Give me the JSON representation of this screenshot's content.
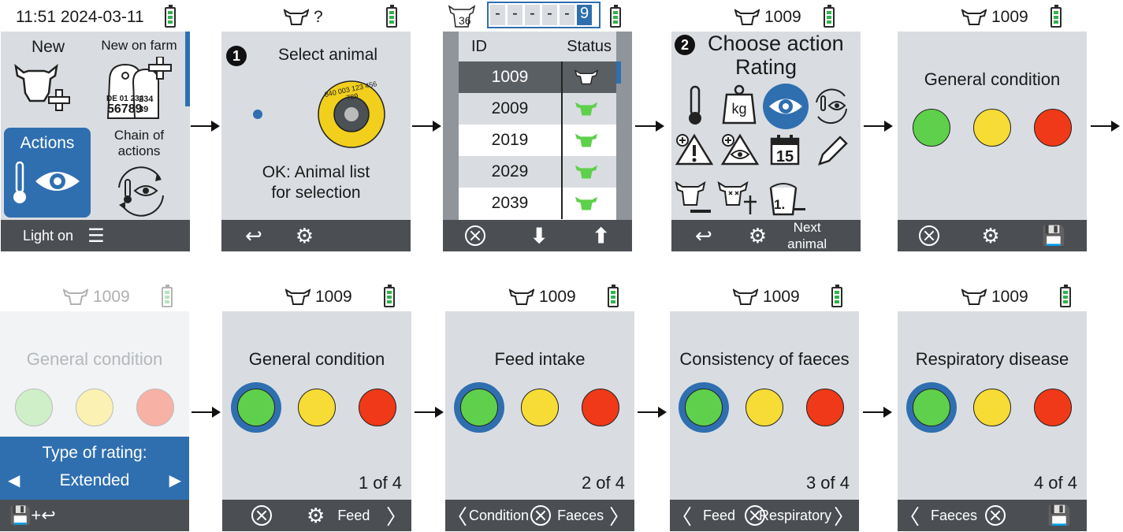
{
  "row1": {
    "s1": {
      "time": "11:51 2024-03-11",
      "new": "New",
      "new_on_farm": "New on farm",
      "actions": "Actions",
      "chain": "Chain of\nactions",
      "light": "Light on",
      "tag_line1": "DE 01 234",
      "tag_line2": "56789",
      "tag_side": "234\n39"
    },
    "s2": {
      "id": "?",
      "step": "1",
      "title": "Select animal",
      "ok": "OK: Animal list\nfor selection",
      "tag_text": "840 003 123 456 789"
    },
    "s3": {
      "count": "36",
      "digits": [
        "-",
        "-",
        "-",
        "-",
        "-",
        "9"
      ],
      "col_id": "ID",
      "col_status": "Status",
      "rows": [
        "1009",
        "2009",
        "2019",
        "2029",
        "2039"
      ]
    },
    "s4": {
      "id": "1009",
      "step": "2",
      "title1": "Choose action",
      "title2": "Rating",
      "next": "Next\nanimal",
      "kg": "kg",
      "cal": "15",
      "feed_label": "1."
    },
    "s5": {
      "id": "1009",
      "title": "General condition"
    }
  },
  "row2": {
    "s6": {
      "id": "1009",
      "title": "General condition",
      "type_label": "Type of rating:",
      "type_value": "Extended"
    },
    "s7": {
      "id": "1009",
      "title": "General condition",
      "counter": "1 of 4",
      "next": "Feed"
    },
    "s8": {
      "id": "1009",
      "title": "Feed intake",
      "counter": "2 of 4",
      "prev": "Condition",
      "next": "Faeces"
    },
    "s9": {
      "id": "1009",
      "title": "Consistency of faeces",
      "counter": "3 of 4",
      "prev": "Feed",
      "next": "Respiratory"
    },
    "s10": {
      "id": "1009",
      "title": "Respiratory disease",
      "counter": "4 of 4",
      "prev": "Faeces"
    }
  },
  "colors": {
    "screen": "#d9dde2",
    "bar": "#4b4f54",
    "accent": "#2f6fb0",
    "green": "#5fd04b",
    "yellow": "#f7dc35",
    "red": "#f03918"
  }
}
